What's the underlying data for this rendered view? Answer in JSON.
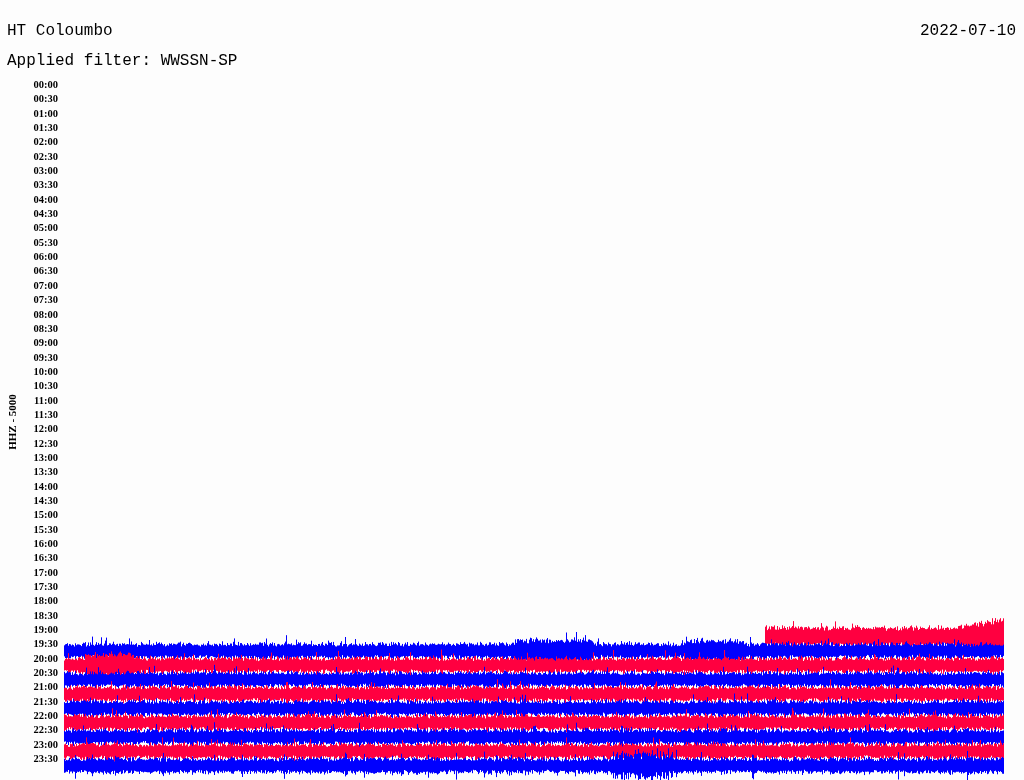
{
  "header": {
    "station": "HT Coloumbo",
    "date": "2022-07-10",
    "filter": "Applied filter: WWSSN-SP"
  },
  "axis_label": "HHZ - 5000",
  "rows": [
    {
      "time": "00:00"
    },
    {
      "time": "00:30"
    },
    {
      "time": "01:00"
    },
    {
      "time": "01:30"
    },
    {
      "time": "02:00"
    },
    {
      "time": "02:30"
    },
    {
      "time": "03:00"
    },
    {
      "time": "03:30"
    },
    {
      "time": "04:00"
    },
    {
      "time": "04:30"
    },
    {
      "time": "05:00"
    },
    {
      "time": "05:30"
    },
    {
      "time": "06:00"
    },
    {
      "time": "06:30"
    },
    {
      "time": "07:00"
    },
    {
      "time": "07:30"
    },
    {
      "time": "08:00"
    },
    {
      "time": "08:30"
    },
    {
      "time": "09:00"
    },
    {
      "time": "09:30"
    },
    {
      "time": "10:00"
    },
    {
      "time": "10:30"
    },
    {
      "time": "11:00"
    },
    {
      "time": "11:30"
    },
    {
      "time": "12:00"
    },
    {
      "time": "12:30"
    },
    {
      "time": "13:00"
    },
    {
      "time": "13:30"
    },
    {
      "time": "14:00"
    },
    {
      "time": "14:30"
    },
    {
      "time": "15:00"
    },
    {
      "time": "15:30"
    },
    {
      "time": "16:00"
    },
    {
      "time": "16:30"
    },
    {
      "time": "17:00"
    },
    {
      "time": "17:30"
    },
    {
      "time": "18:00"
    },
    {
      "time": "18:30"
    },
    {
      "time": "19:00",
      "trace": {
        "color": "#ff0040",
        "partial": true
      }
    },
    {
      "time": "19:30",
      "trace": {
        "color": "#0000ff",
        "partial": false
      }
    },
    {
      "time": "20:00",
      "trace": {
        "color": "#ff0040",
        "partial": false
      }
    },
    {
      "time": "20:30",
      "trace": {
        "color": "#0000ff",
        "partial": false
      }
    },
    {
      "time": "21:00",
      "trace": {
        "color": "#ff0040",
        "partial": false
      }
    },
    {
      "time": "21:30",
      "trace": {
        "color": "#0000ff",
        "partial": false
      }
    },
    {
      "time": "22:00",
      "trace": {
        "color": "#ff0040",
        "partial": false
      }
    },
    {
      "time": "22:30",
      "trace": {
        "color": "#0000ff",
        "partial": false
      }
    },
    {
      "time": "23:00",
      "trace": {
        "color": "#ff0040",
        "partial": false
      }
    },
    {
      "time": "23:30",
      "trace": {
        "color": "#0000ff",
        "partial": false
      }
    }
  ]
}
